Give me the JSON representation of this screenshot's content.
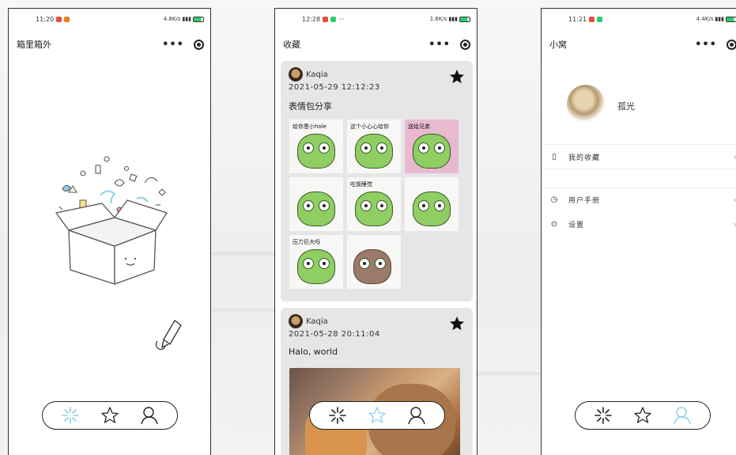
{
  "colors": {
    "tab_active": "#8ccfe8",
    "card_bg": "#e6e6e6",
    "border": "#222222"
  },
  "screens": [
    {
      "status": {
        "time": "11:20",
        "speed": "4.8K/s"
      },
      "title": "箱里箱外",
      "tabs": [
        {
          "icon": "spark-icon",
          "active": true
        },
        {
          "icon": "star-outline-icon",
          "active": false
        },
        {
          "icon": "person-icon",
          "active": false
        }
      ]
    },
    {
      "status": {
        "time": "12:28",
        "speed": "1.6K/s"
      },
      "title": "收藏",
      "posts": [
        {
          "author": "Kaqia",
          "time": "2021-05-29  12:12:23",
          "text": "表情包分享",
          "stickers": [
            "给你恩小hole",
            "这个小心心给你",
            "送给兄弟",
            "",
            "吃饭睡觉",
            "",
            "压力巨大吗",
            "",
            ""
          ]
        },
        {
          "author": "Kaqia",
          "time": "2021-05-28  20:11:04",
          "text": "Halo, world"
        }
      ],
      "tabs": [
        {
          "icon": "spark-icon",
          "active": false
        },
        {
          "icon": "star-outline-icon",
          "active": true
        },
        {
          "icon": "person-icon",
          "active": false
        }
      ]
    },
    {
      "status": {
        "time": "11:21",
        "speed": "4.4K/s"
      },
      "title": "小窝",
      "profile": {
        "name": "孤光"
      },
      "menu": [
        {
          "icon": "document-icon",
          "label": "我的收藏"
        },
        {
          "icon": "clock-icon",
          "label": "用户手册"
        },
        {
          "icon": "gear-icon",
          "label": "设置"
        }
      ],
      "tabs": [
        {
          "icon": "spark-icon",
          "active": false
        },
        {
          "icon": "star-outline-icon",
          "active": false
        },
        {
          "icon": "person-icon",
          "active": true
        }
      ]
    }
  ]
}
